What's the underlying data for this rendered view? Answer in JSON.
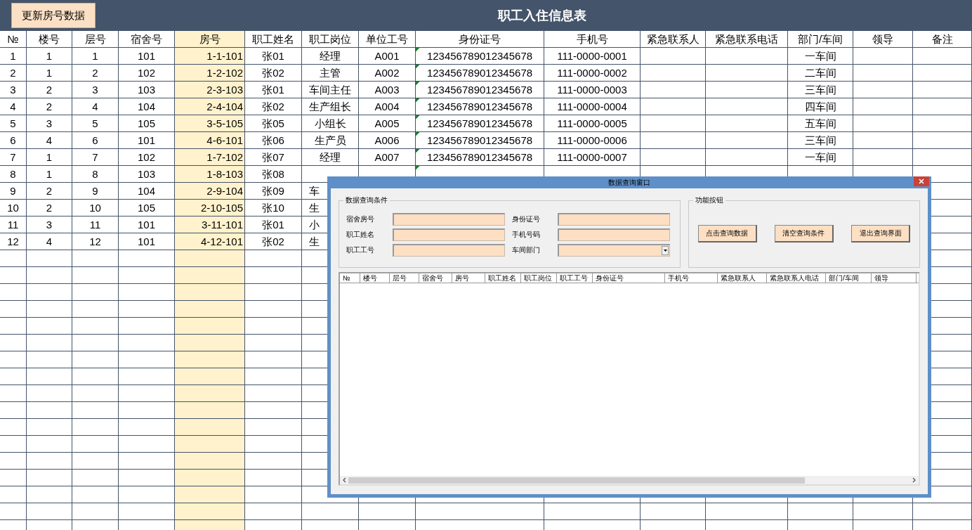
{
  "header": {
    "button": "更新房号数据",
    "title": "职工入住信息表"
  },
  "sheet": {
    "columns": [
      {
        "label": "№",
        "highlight": false
      },
      {
        "label": "楼号",
        "highlight": false
      },
      {
        "label": "层号",
        "highlight": false
      },
      {
        "label": "宿舍号",
        "highlight": false
      },
      {
        "label": "房号",
        "highlight": true
      },
      {
        "label": "职工姓名",
        "highlight": false
      },
      {
        "label": "职工岗位",
        "highlight": false
      },
      {
        "label": "单位工号",
        "highlight": false
      },
      {
        "label": "身份证号",
        "highlight": false
      },
      {
        "label": "手机号",
        "highlight": false
      },
      {
        "label": "紧急联系人",
        "highlight": false
      },
      {
        "label": "紧急联系电话",
        "highlight": false
      },
      {
        "label": "部门/车间",
        "highlight": false
      },
      {
        "label": "领导",
        "highlight": false
      },
      {
        "label": "备注",
        "highlight": false
      }
    ],
    "rows": [
      {
        "cells": [
          "1",
          "1",
          "1",
          "101",
          "1-1-101",
          "张01",
          "经理",
          "A001",
          "123456789012345678",
          "111-0000-0001"
        ],
        "department": "一车间",
        "id_warning": true
      },
      {
        "cells": [
          "2",
          "1",
          "2",
          "102",
          "1-2-102",
          "张02",
          "主管",
          "A002",
          "123456789012345678",
          "111-0000-0002"
        ],
        "department": "二车间",
        "id_warning": true
      },
      {
        "cells": [
          "3",
          "2",
          "3",
          "103",
          "2-3-103",
          "张01",
          "车间主任",
          "A003",
          "123456789012345678",
          "111-0000-0003"
        ],
        "department": "三车间",
        "id_warning": true
      },
      {
        "cells": [
          "4",
          "2",
          "4",
          "104",
          "2-4-104",
          "张02",
          "生产组长",
          "A004",
          "123456789012345678",
          "111-0000-0004"
        ],
        "department": "四车间",
        "id_warning": true
      },
      {
        "cells": [
          "5",
          "3",
          "5",
          "105",
          "3-5-105",
          "张05",
          "小组长",
          "A005",
          "123456789012345678",
          "111-0000-0005"
        ],
        "department": "五车间",
        "id_warning": true
      },
      {
        "cells": [
          "6",
          "4",
          "6",
          "101",
          "4-6-101",
          "张06",
          "生产员",
          "A006",
          "123456789012345678",
          "111-0000-0006"
        ],
        "department": "三车间",
        "id_warning": true
      },
      {
        "cells": [
          "7",
          "1",
          "7",
          "102",
          "1-7-102",
          "张07",
          "经理",
          "A007",
          "123456789012345678",
          "111-0000-0007"
        ],
        "department": "一车间",
        "id_warning": true
      },
      {
        "cells": [
          "8",
          "1",
          "8",
          "103",
          "1-8-103",
          "张08"
        ],
        "id_warning": true
      },
      {
        "cells": [
          "9",
          "2",
          "9",
          "104",
          "2-9-104",
          "张09",
          "车"
        ]
      },
      {
        "cells": [
          "10",
          "2",
          "10",
          "105",
          "2-10-105",
          "张10",
          "生"
        ]
      },
      {
        "cells": [
          "11",
          "3",
          "11",
          "101",
          "3-11-101",
          "张01",
          "小"
        ]
      },
      {
        "cells": [
          "12",
          "4",
          "12",
          "101",
          "4-12-101",
          "张02",
          "生"
        ]
      }
    ]
  },
  "dialog": {
    "title": "数据查询窗口",
    "query_group": {
      "title": "数据查询条件",
      "fields": [
        {
          "label": "宿舍房号",
          "kind": "text"
        },
        {
          "label": "身份证号",
          "kind": "text"
        },
        {
          "label": "职工姓名",
          "kind": "text"
        },
        {
          "label": "手机号码",
          "kind": "text"
        },
        {
          "label": "职工工号",
          "kind": "text"
        },
        {
          "label": "车间部门",
          "kind": "dropdown"
        }
      ]
    },
    "button_group": {
      "title": "功能按钮",
      "buttons": [
        "点击查询数据",
        "清空查询条件",
        "退出查询界面"
      ]
    },
    "results": {
      "columns": [
        "№",
        "楼号",
        "层号",
        "宿舍号",
        "房号",
        "职工姓名",
        "职工岗位",
        "职工工号",
        "身份证号",
        "手机号",
        "紧急联系人",
        "紧急联系人电话",
        "部门/车间",
        "领导"
      ]
    }
  }
}
